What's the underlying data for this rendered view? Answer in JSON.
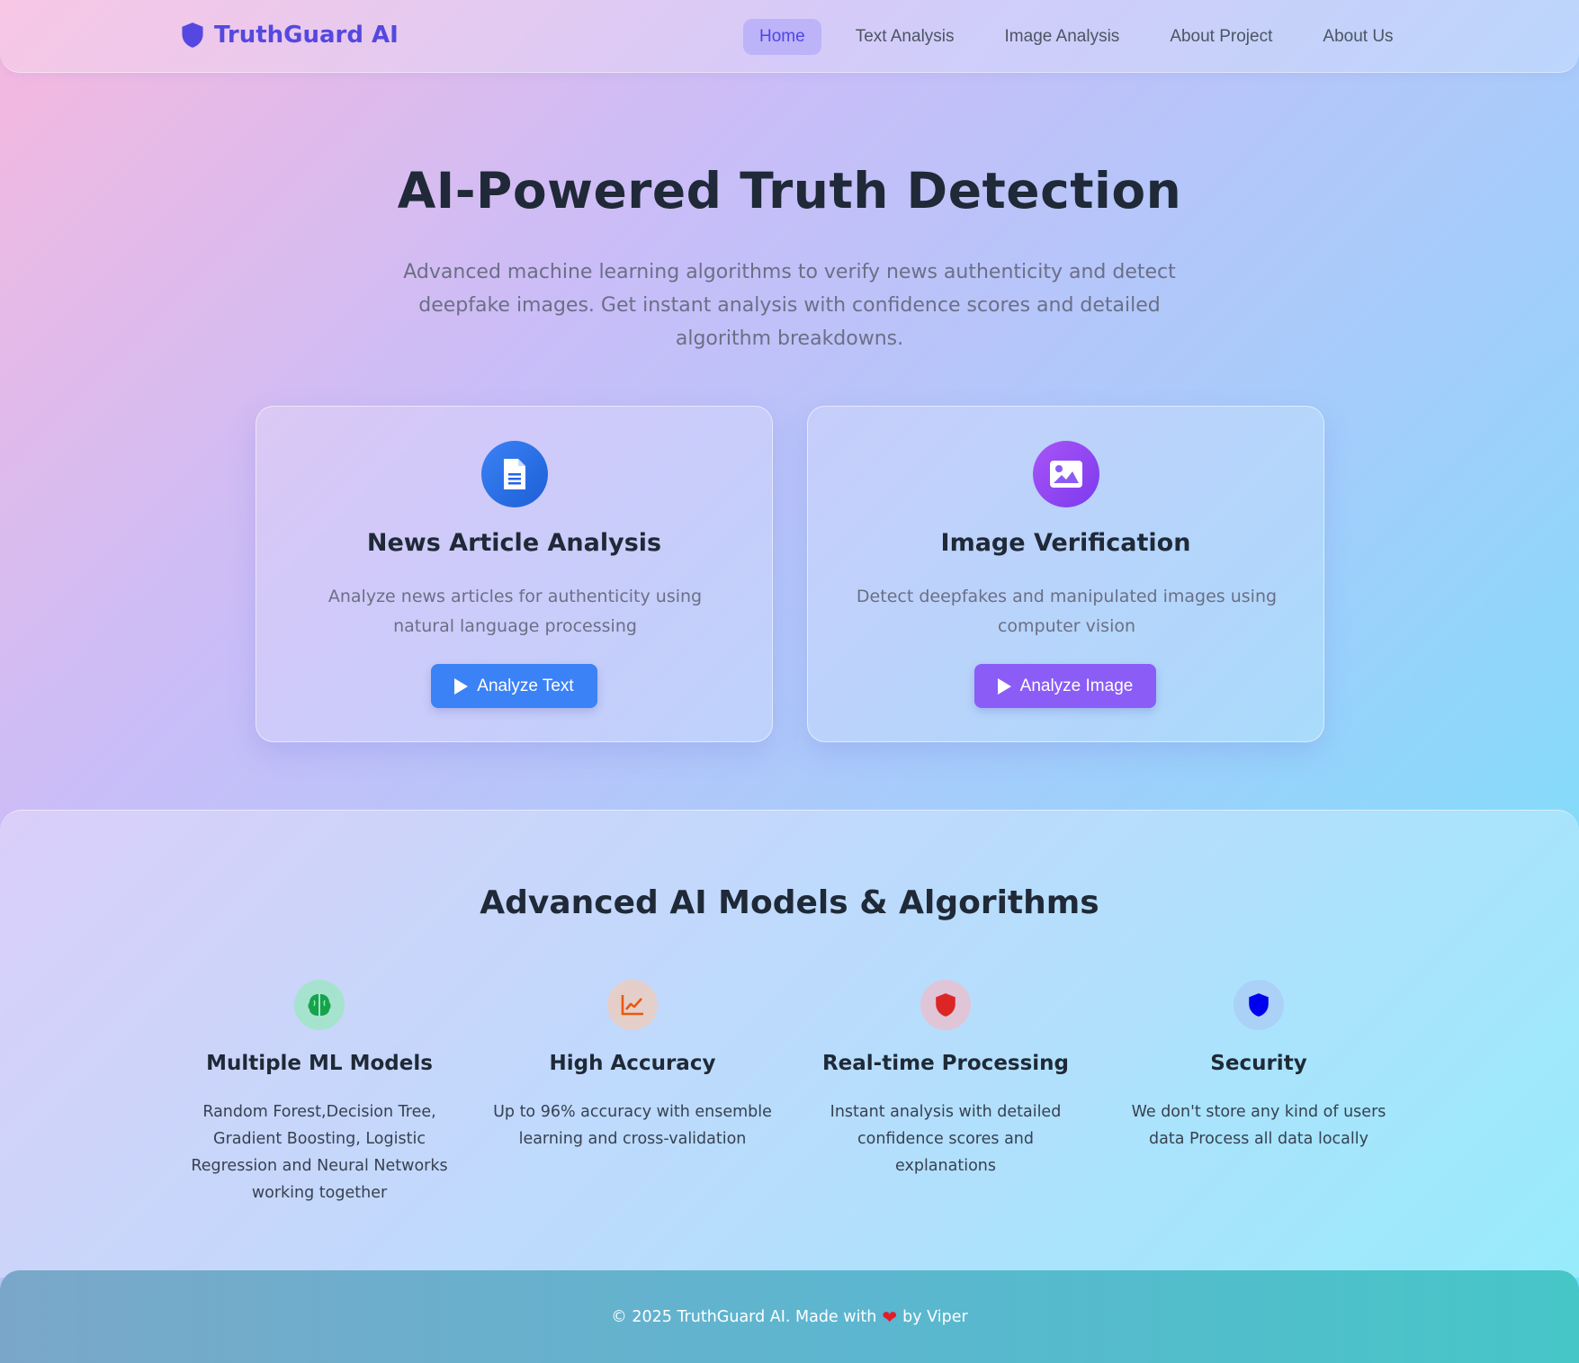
{
  "brand": {
    "name": "TruthGuard AI",
    "icon": "shield-icon",
    "color": "#5548e0"
  },
  "nav": {
    "items": [
      {
        "label": "Home",
        "active": true
      },
      {
        "label": "Text Analysis",
        "active": false
      },
      {
        "label": "Image Analysis",
        "active": false
      },
      {
        "label": "About Project",
        "active": false
      },
      {
        "label": "About Us",
        "active": false
      }
    ]
  },
  "hero": {
    "title": "AI-Powered Truth Detection",
    "subtitle": "Advanced machine learning algorithms to verify news authenticity and detect deepfake images. Get instant analysis with confidence scores and detailed algorithm breakdowns."
  },
  "cards": [
    {
      "icon": "document-icon",
      "title": "News Article Analysis",
      "description": "Analyze news articles for authenticity using natural language processing",
      "button_label": "Analyze Text",
      "accent": "#3b82f6"
    },
    {
      "icon": "image-icon",
      "title": "Image Verification",
      "description": "Detect deepfakes and manipulated images using computer vision",
      "button_label": "Analyze Image",
      "accent": "#8b5cf6"
    }
  ],
  "features": {
    "title": "Advanced AI Models & Algorithms",
    "items": [
      {
        "icon": "brain-icon",
        "icon_color": "#16a34a",
        "title": "Multiple ML Models",
        "description": "Random Forest,Decision Tree, Gradient Boosting, Logistic Regression and Neural Networks working together"
      },
      {
        "icon": "chart-line-icon",
        "icon_color": "#ea580c",
        "title": "High Accuracy",
        "description": "Up to 96% accuracy with ensemble learning and cross-validation"
      },
      {
        "icon": "shield-icon",
        "icon_color": "#dc2626",
        "title": "Real-time Processing",
        "description": "Instant analysis with detailed confidence scores and explanations"
      },
      {
        "icon": "shield-icon",
        "icon_color": "#0000ee",
        "title": "Security",
        "description": "We don't store any kind of users data Process all data locally"
      }
    ]
  },
  "footer": {
    "text_before": "© 2025 TruthGuard AI. Made with",
    "heart_icon": "heart-icon",
    "text_after": "by Viper"
  }
}
